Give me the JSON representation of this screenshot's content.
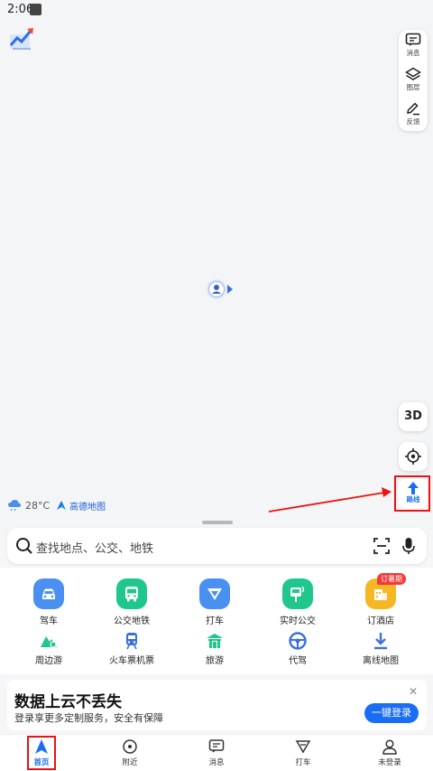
{
  "status_bar": {
    "time": "2:06"
  },
  "map_controls": {
    "messages_label": "消息",
    "layers_label": "图层",
    "feedback_label": "反馈",
    "three_d_label": "3D",
    "route_label": "路线"
  },
  "weather": {
    "temperature": "28°C"
  },
  "brand": {
    "name": "高德地图"
  },
  "search": {
    "placeholder": "查找地点、公交、地铁"
  },
  "services_row1": [
    {
      "label": "驾车",
      "icon": "car-icon",
      "color": "#4a90f0"
    },
    {
      "label": "公交地铁",
      "icon": "bus-icon",
      "color": "#1fc78c"
    },
    {
      "label": "打车",
      "icon": "taxi-icon",
      "color": "#4a90f0"
    },
    {
      "label": "实时公交",
      "icon": "realtime-bus-icon",
      "color": "#1fc78c"
    },
    {
      "label": "订酒店",
      "icon": "hotel-icon",
      "color": "#f6b724",
      "badge": "订暑期"
    }
  ],
  "services_row2": [
    {
      "label": "周边游",
      "icon": "nearby-travel-icon"
    },
    {
      "label": "火车票机票",
      "icon": "train-ticket-icon"
    },
    {
      "label": "旅游",
      "icon": "travel-icon"
    },
    {
      "label": "代驾",
      "icon": "designated-driver-icon"
    },
    {
      "label": "离线地图",
      "icon": "offline-map-icon"
    }
  ],
  "promo": {
    "title": "数据上云不丢失",
    "subtitle": "登录享更多定制服务，安全有保障",
    "button": "一键登录",
    "close": "✕"
  },
  "bottom_nav": [
    {
      "label": "首页",
      "icon": "home-icon",
      "active": true
    },
    {
      "label": "附近",
      "icon": "nearby-icon"
    },
    {
      "label": "消息",
      "icon": "message-icon"
    },
    {
      "label": "打车",
      "icon": "taxi-icon"
    },
    {
      "label": "未登录",
      "icon": "user-icon"
    }
  ],
  "colors": {
    "accent": "#1b6ef3",
    "annotation": "#e11111"
  }
}
